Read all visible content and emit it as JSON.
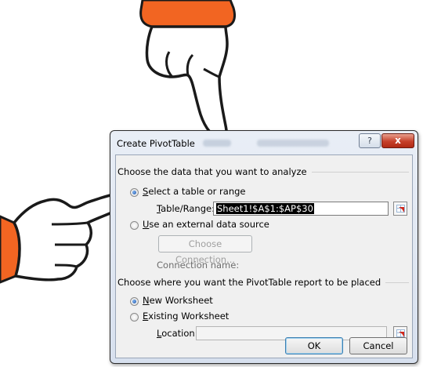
{
  "dialog": {
    "title": "Create PivotTable",
    "help_label": "?",
    "close_label": "x"
  },
  "analyze_section": {
    "heading": "Choose the data that you want to analyze",
    "option_table": {
      "accesskey": "S",
      "rest": "elect a table or range",
      "checked": true
    },
    "table_range": {
      "accesskey": "T",
      "rest": "able/Range:",
      "value": "Sheet1!$A$1:$AP$30"
    },
    "option_external": {
      "accesskey": "U",
      "rest": "se an external data source",
      "checked": false
    },
    "choose_connection_label": "Choose Connection...",
    "connection_name_label": "Connection name:"
  },
  "placement_section": {
    "heading": "Choose where you want the PivotTable report to be placed",
    "option_new": {
      "accesskey": "N",
      "rest": "ew Worksheet",
      "checked": true
    },
    "option_existing": {
      "accesskey": "E",
      "rest": "xisting Worksheet",
      "checked": false
    },
    "location": {
      "accesskey": "L",
      "rest": "ocation:",
      "value": ""
    }
  },
  "buttons": {
    "ok": "OK",
    "cancel": "Cancel"
  },
  "colors": {
    "hand_sleeve": "#f26522",
    "hand_outline": "#1a1a1a",
    "selection_bg": "#000000"
  },
  "icons": [
    "pointing-hand-down",
    "pointing-hand-right",
    "range-picker-icon"
  ]
}
